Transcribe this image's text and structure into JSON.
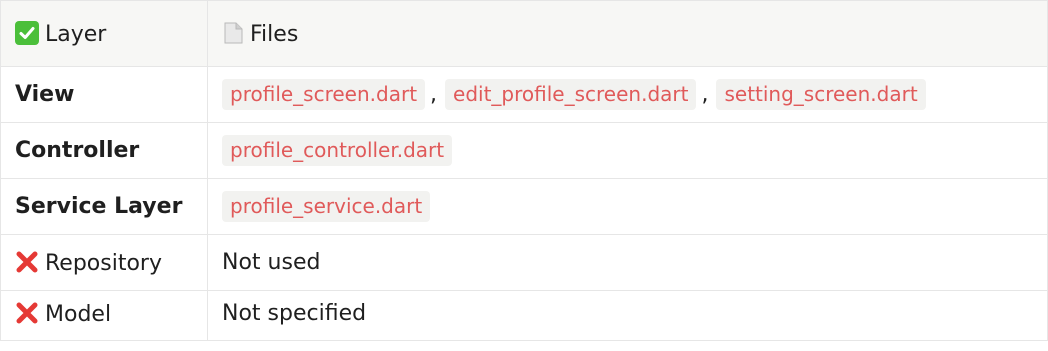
{
  "table": {
    "headers": {
      "layer": "Layer",
      "files": "Files"
    },
    "header_icons": {
      "layer": "check-mark-icon",
      "files": "document-icon"
    },
    "rows": [
      {
        "layer": "View",
        "files": [
          "profile_screen.dart",
          "edit_profile_screen.dart",
          "setting_screen.dart"
        ],
        "separator": ","
      },
      {
        "layer": "Controller",
        "files": [
          "profile_controller.dart"
        ]
      },
      {
        "layer": "Service Layer",
        "files": [
          "profile_service.dart"
        ]
      },
      {
        "layer": "Repository",
        "icon": "red-cross-icon",
        "text": "Not used"
      },
      {
        "layer": "Model",
        "icon": "red-cross-icon",
        "text": "Not specified"
      }
    ]
  },
  "colors": {
    "code_text": "#e05a5a",
    "code_background": "#f2f2f0",
    "check_green": "#4bbf3a",
    "cross_red": "#e53935",
    "border": "#e6e6e6"
  }
}
